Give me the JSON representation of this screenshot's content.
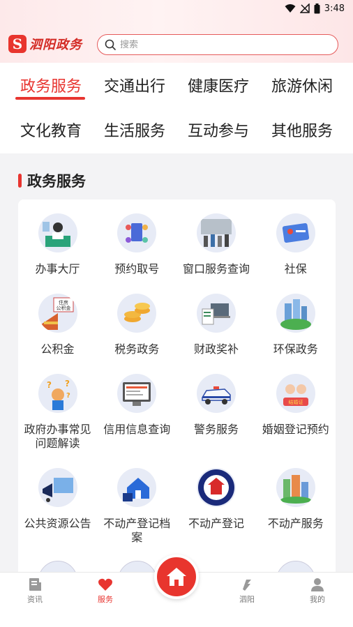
{
  "status_bar": {
    "time": "3:48"
  },
  "header": {
    "app_name": "泗阳政务",
    "logo_letter": "S",
    "search_placeholder": "搜索"
  },
  "categories": [
    {
      "label": "政务服务",
      "active": true
    },
    {
      "label": "交通出行",
      "active": false
    },
    {
      "label": "健康医疗",
      "active": false
    },
    {
      "label": "旅游休闲",
      "active": false
    },
    {
      "label": "文化教育",
      "active": false
    },
    {
      "label": "生活服务",
      "active": false
    },
    {
      "label": "互动参与",
      "active": false
    },
    {
      "label": "其他服务",
      "active": false
    }
  ],
  "section": {
    "title": "政务服务"
  },
  "services": [
    {
      "label": "办事大厅",
      "icon": "service-hall-icon"
    },
    {
      "label": "预约取号",
      "icon": "appointment-icon"
    },
    {
      "label": "窗口服务查询",
      "icon": "window-query-icon"
    },
    {
      "label": "社保",
      "icon": "social-security-icon"
    },
    {
      "label": "公积金",
      "icon": "housing-fund-icon"
    },
    {
      "label": "税务政务",
      "icon": "tax-icon"
    },
    {
      "label": "财政奖补",
      "icon": "finance-icon"
    },
    {
      "label": "环保政务",
      "icon": "environment-icon"
    },
    {
      "label": "政府办事常见问题解读",
      "icon": "faq-icon"
    },
    {
      "label": "信用信息查询",
      "icon": "credit-query-icon"
    },
    {
      "label": "警务服务",
      "icon": "police-icon"
    },
    {
      "label": "婚姻登记预约",
      "icon": "marriage-icon"
    },
    {
      "label": "公共资源公告",
      "icon": "public-resource-icon"
    },
    {
      "label": "不动产登记档案",
      "icon": "property-archive-icon"
    },
    {
      "label": "不动产登记",
      "icon": "property-registration-icon"
    },
    {
      "label": "不动产服务",
      "icon": "property-service-icon"
    }
  ],
  "tabbar": [
    {
      "label": "资讯",
      "icon": "news-icon",
      "active": false
    },
    {
      "label": "服务",
      "icon": "heart-icon",
      "active": true
    },
    {
      "label": "泗阳",
      "icon": "siyang-icon",
      "active": false
    },
    {
      "label": "我的",
      "icon": "user-icon",
      "active": false
    }
  ],
  "colors": {
    "accent": "#e83530",
    "icon_bg": "#e7ebf6"
  }
}
